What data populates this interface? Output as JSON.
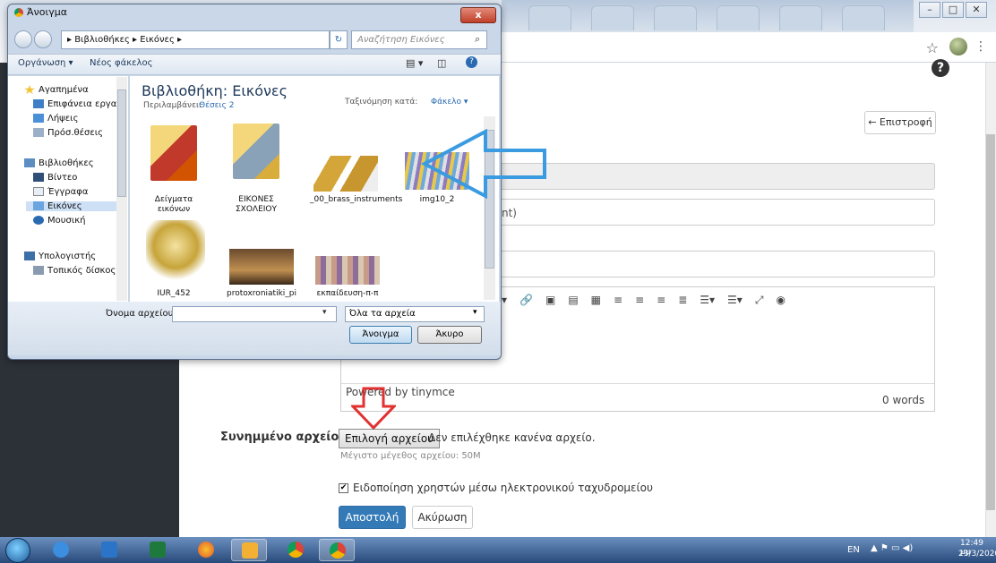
{
  "dialog": {
    "title": "Άνοιγμα",
    "close_label": "x",
    "breadcrumb": "▸ Βιβλιοθήκες ▸ Εικόνες ▸",
    "search_placeholder": "Αναζήτηση Εικόνες",
    "toolbar": {
      "organize": "Οργάνωση ▾",
      "new_folder": "Νέος φάκελος"
    },
    "nav": {
      "favorites": "Αγαπημένα",
      "desktop": "Επιφάνεια εργασ",
      "downloads": "Λήψεις",
      "recent": "Πρόσ.θέσεις",
      "libraries": "Βιβλιοθήκες",
      "videos": "Βίντεο",
      "documents": "Έγγραφα",
      "pictures": "Εικόνες",
      "music": "Μουσική",
      "computer": "Υπολογιστής",
      "local_disk": "Τοπικός δίσκος ("
    },
    "library_title": "Βιβλιοθήκη: Εικόνες",
    "library_includes": "Περιλαμβάνει:",
    "library_locations": "Θέσεις 2",
    "sort_label": "Ταξινόμηση κατά:",
    "sort_value": "Φάκελο ▾",
    "files": [
      {
        "label": "Δείγματα εικόνων"
      },
      {
        "label": "ΕΙΚΟΝΕΣ ΣΧΟΛΕΙΟΥ"
      },
      {
        "label": "_00_brass_instruments"
      },
      {
        "label": "img10_2"
      },
      {
        "label": "IUR_452"
      },
      {
        "label": "protoxroniatiki_pi"
      },
      {
        "label": "εκπαίδευση-π-π"
      }
    ],
    "filename_label": "Όνομα αρχείου:",
    "filename_value": "",
    "filter_value": "Όλα τα αρχεία",
    "open_button": "Άνοιγμα",
    "cancel_button": "Άκυρο"
  },
  "page": {
    "back_button": "← Επιστροφή",
    "field2_text": "nt)",
    "editor_powered": "Powered by tinymce",
    "editor_words": "0 words",
    "attach_label": "Συνημμένο αρχείο:",
    "choose_file": "Επιλογή αρχείου",
    "no_file": "Δεν επιλέχθηκε κανένα αρχείο.",
    "max_size": "Μέγιστο μέγεθος αρχείου: 50M",
    "notify_text": "Ειδοποίηση χρηστών μέσω ηλεκτρονικού ταχυδρομείου",
    "notify_checked": true,
    "send_button": "Αποστολή",
    "cancel_button": "Ακύρωση"
  },
  "browser": {
    "help": "?"
  },
  "taskbar": {
    "lang": "EN",
    "time": "12:49 μμ",
    "date": "23/3/2020"
  },
  "colors": {
    "arrow_blue": "#3a9be0",
    "arrow_red": "#e23131",
    "primary": "#337ab7"
  }
}
